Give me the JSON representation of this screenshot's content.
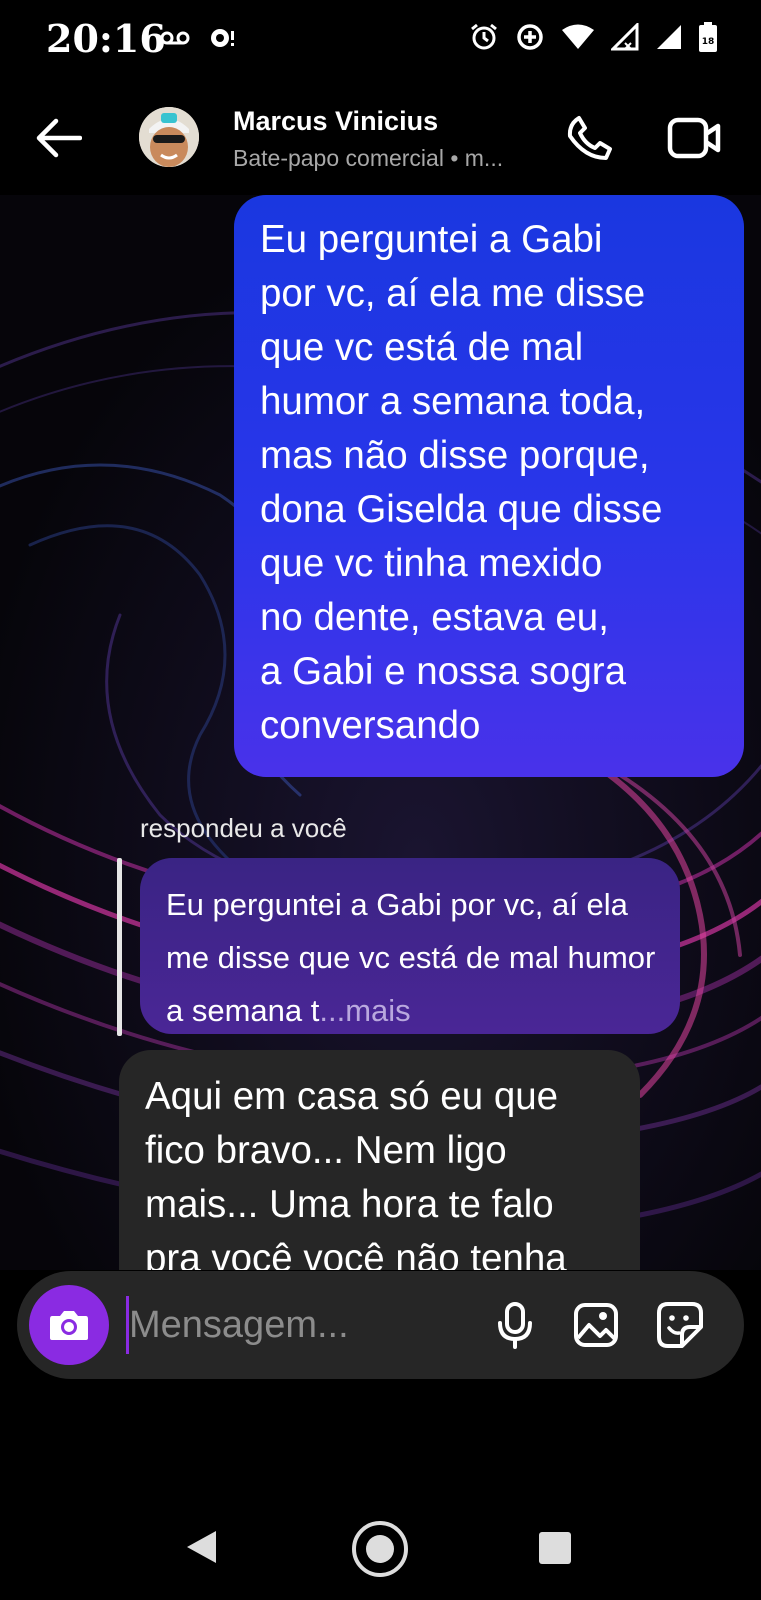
{
  "status_bar": {
    "time": "20:16",
    "left_icons": [
      "voicemail-icon",
      "notification-icon"
    ],
    "right_icons": [
      "alarm-icon",
      "data-saver-icon",
      "wifi-icon",
      "signal-icon",
      "signal-icon",
      "battery-icon"
    ],
    "battery_level": "18"
  },
  "header": {
    "contact_name": "Marcus Vinicius",
    "contact_subtitle": "Bate-papo comercial • m...",
    "icons": {
      "back": "arrow-left-icon",
      "call": "phone-icon",
      "video": "video-camera-icon"
    }
  },
  "messages": {
    "sent": {
      "text": "Eu perguntei a Gabi\npor vc, aí ela me disse\nque vc está de mal\nhumor a semana toda,\nmas não disse porque,\ndona Giselda que disse\nque vc tinha mexido\nno dente, estava eu,\na Gabi e nossa sogra\nconversando"
    },
    "reply": {
      "label": "respondeu a você",
      "quoted_text": "Eu perguntei a Gabi por vc, aí ela me disse que vc está de mal humor a semana t",
      "quoted_ellipsis": "...",
      "quoted_more": "mais"
    },
    "received": {
      "text": "Aqui em casa só eu que\nfico bravo... Nem ligo\nmais... Uma hora te falo\npra você você não tenha"
    }
  },
  "composer": {
    "placeholder": "Mensagem...",
    "value": "",
    "icons": {
      "camera": "camera-icon",
      "mic": "microphone-icon",
      "gallery": "image-icon",
      "sticker": "sticker-icon"
    },
    "accent_color": "#8a2be2"
  },
  "nav_bar": {
    "icons": [
      "nav-back-icon",
      "nav-home-icon",
      "nav-recents-icon"
    ]
  },
  "colors": {
    "sent_bubble_top": "#1a37e0",
    "sent_bubble_bottom": "#4932ea",
    "received_bubble": "#262626",
    "quoted_bubble": "#3a2484"
  }
}
